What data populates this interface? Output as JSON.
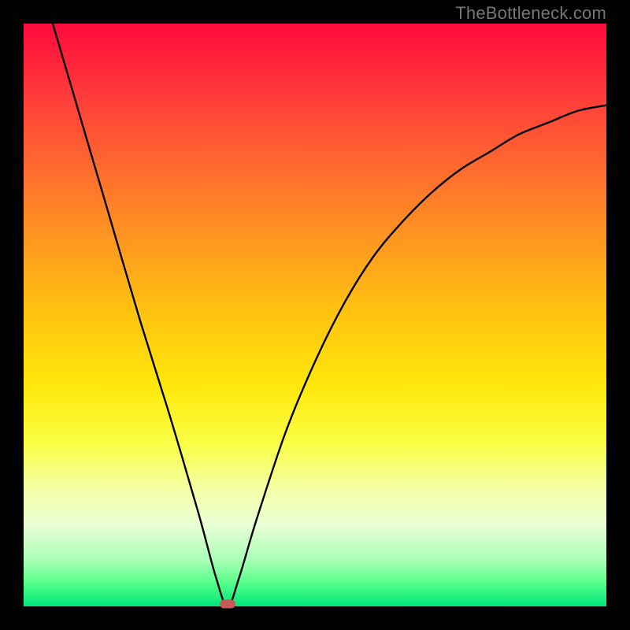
{
  "watermark": "TheBottleneck.com",
  "colors": {
    "frame": "#000000",
    "gradient_top": "#ff0a3c",
    "gradient_bottom": "#00e67a",
    "curve": "#000000",
    "marker": "#c85a5a"
  },
  "chart_data": {
    "type": "line",
    "title": "",
    "xlabel": "",
    "ylabel": "",
    "xlim": [
      0,
      100
    ],
    "ylim": [
      0,
      100
    ],
    "grid": false,
    "legend": false,
    "minimum": {
      "x": 35,
      "y": 0
    },
    "series": [
      {
        "name": "curve",
        "x": [
          5,
          10,
          15,
          20,
          25,
          30,
          33,
          35,
          37,
          40,
          45,
          50,
          55,
          60,
          65,
          70,
          75,
          80,
          85,
          90,
          95,
          100
        ],
        "y": [
          100,
          83,
          66,
          49,
          33,
          16,
          5,
          0,
          5,
          15,
          30,
          42,
          52,
          60,
          66,
          71,
          75,
          78,
          81,
          83,
          85,
          86
        ]
      }
    ]
  }
}
